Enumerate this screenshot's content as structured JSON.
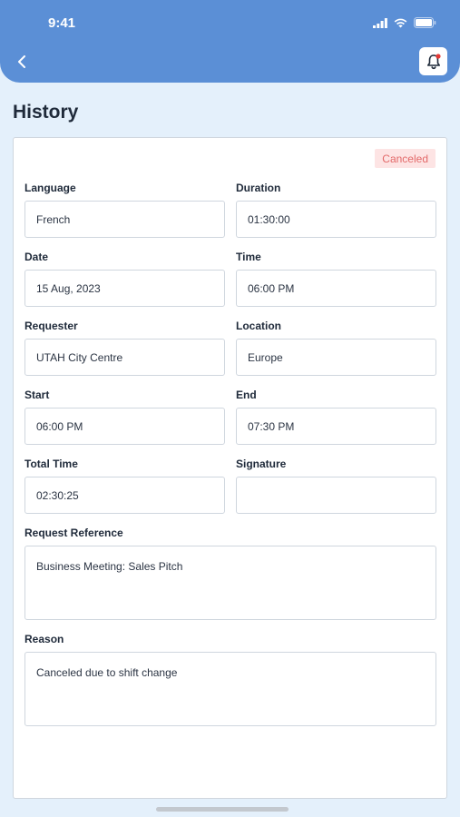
{
  "status_bar": {
    "time": "9:41"
  },
  "header": {
    "back_icon": "chevron-left-icon",
    "bell_icon": "bell-icon",
    "accent": "#5b8fd6"
  },
  "page": {
    "title": "History"
  },
  "card": {
    "status_badge": "Canceled",
    "fields": {
      "language": {
        "label": "Language",
        "value": "French"
      },
      "duration": {
        "label": "Duration",
        "value": "01:30:00"
      },
      "date": {
        "label": "Date",
        "value": "15 Aug, 2023"
      },
      "time": {
        "label": "Time",
        "value": "06:00 PM"
      },
      "requester": {
        "label": "Requester",
        "value": "UTAH City Centre"
      },
      "location": {
        "label": "Location",
        "value": "Europe"
      },
      "start": {
        "label": "Start",
        "value": "06:00 PM"
      },
      "end": {
        "label": "End",
        "value": "07:30 PM"
      },
      "total_time": {
        "label": "Total Time",
        "value": "02:30:25"
      },
      "signature": {
        "label": "Signature",
        "value": ""
      },
      "request_reference": {
        "label": "Request Reference",
        "value": "Business Meeting: Sales Pitch"
      },
      "reason": {
        "label": "Reason",
        "value": "Canceled due to shift change"
      }
    }
  }
}
